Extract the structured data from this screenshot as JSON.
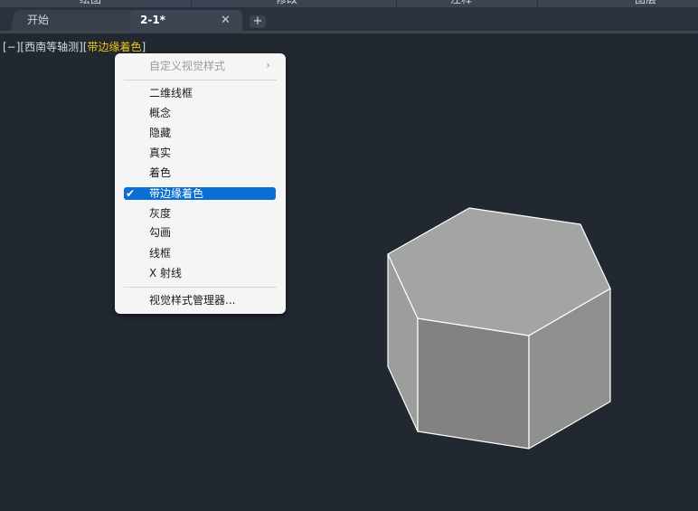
{
  "ribbon": {
    "labels": [
      "绘图",
      "修改",
      "注释",
      "图层"
    ]
  },
  "tabs": {
    "start_label": "开始",
    "active_label": "2-1*",
    "close_glyph": "✕",
    "add_glyph": "+"
  },
  "viewport": {
    "prefix": "[−][西南等轴测][",
    "visual_style": "带边缘着色",
    "suffix": "]"
  },
  "menu": {
    "custom_styles": "自定义视觉样式",
    "items": [
      "二维线框",
      "概念",
      "隐藏",
      "真实",
      "着色",
      "带边缘着色",
      "灰度",
      "勾画",
      "线框",
      "X 射线"
    ],
    "selected": "带边缘着色",
    "manager": "视觉样式管理器...",
    "check_glyph": "✔",
    "submenu_glyph": "›"
  },
  "model": {
    "shape": "hexagonal-prism",
    "top_color": "#a3a5a2",
    "left_color": "#9c9e9c",
    "front_color": "#828282",
    "right_color": "#8f918f",
    "edge_color": "#ffffff"
  }
}
